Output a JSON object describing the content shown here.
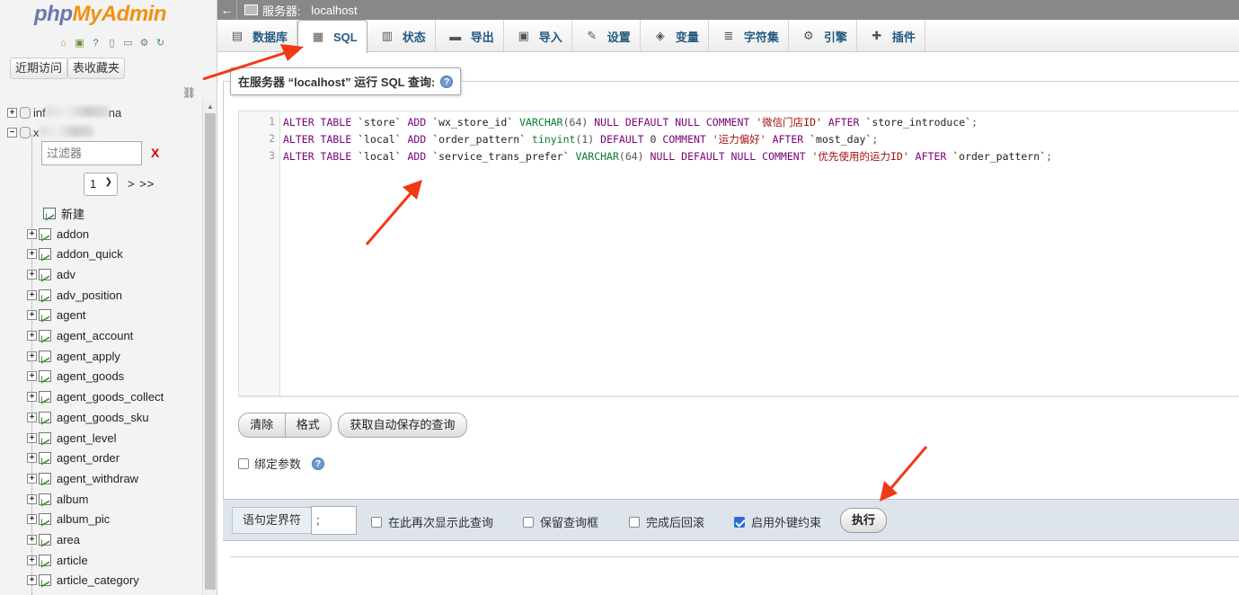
{
  "app": {
    "logo_php": "php",
    "logo_myadmin": "MyAdmin"
  },
  "nav": {
    "icons": [
      "home-icon",
      "logout-icon",
      "help-icon",
      "docs-icon",
      "copy-icon",
      "settings-icon",
      "reload-icon"
    ],
    "recent_button": "近期访问",
    "favorites_button": "表收藏夹",
    "databases": [
      {
        "name_prefix": "inf",
        "name_suffix": "na",
        "expanded": false
      },
      {
        "name_prefix": "x",
        "name_suffix": "",
        "expanded": true
      }
    ],
    "filter_placeholder": "过滤器",
    "filter_clear": "X",
    "page_select": "1",
    "page_next": "> >>",
    "new_label": "新建",
    "tables": [
      "addon",
      "addon_quick",
      "adv",
      "adv_position",
      "agent",
      "agent_account",
      "agent_apply",
      "agent_goods",
      "agent_goods_collect",
      "agent_goods_sku",
      "agent_level",
      "agent_order",
      "agent_withdraw",
      "album",
      "album_pic",
      "area",
      "article",
      "article_category"
    ]
  },
  "topbar": {
    "back": "←",
    "server_label": "服务器:",
    "server_name": "localhost"
  },
  "tabs": [
    {
      "label": "数据库",
      "icon": "database-icon"
    },
    {
      "label": "SQL",
      "icon": "sql-icon",
      "active": true
    },
    {
      "label": "状态",
      "icon": "status-icon"
    },
    {
      "label": "导出",
      "icon": "export-icon"
    },
    {
      "label": "导入",
      "icon": "import-icon"
    },
    {
      "label": "设置",
      "icon": "wrench-icon"
    },
    {
      "label": "变量",
      "icon": "variables-icon"
    },
    {
      "label": "字符集",
      "icon": "charset-icon"
    },
    {
      "label": "引擎",
      "icon": "engine-icon"
    },
    {
      "label": "插件",
      "icon": "plugin-icon"
    }
  ],
  "query": {
    "title": "在服务器 “localhost” 运行 SQL 查询:",
    "lines": [
      {
        "num": "1",
        "tokens": [
          [
            "kw",
            "ALTER TABLE "
          ],
          [
            "id",
            "`store` "
          ],
          [
            "kw",
            "ADD "
          ],
          [
            "id",
            "`wx_store_id` "
          ],
          [
            "ty",
            "VARCHAR"
          ],
          [
            "pn",
            "(64) "
          ],
          [
            "kw",
            "NULL DEFAULT NULL COMMENT "
          ],
          [
            "str",
            "'微信门店ID' "
          ],
          [
            "kw",
            "AFTER "
          ],
          [
            "id",
            "`store_introduce`"
          ],
          [
            "pn",
            ";"
          ]
        ]
      },
      {
        "num": "2",
        "tokens": [
          [
            "kw",
            "ALTER TABLE "
          ],
          [
            "id",
            "`local` "
          ],
          [
            "kw",
            "ADD "
          ],
          [
            "id",
            "`order_pattern` "
          ],
          [
            "ty",
            "tinyint"
          ],
          [
            "pn",
            "(1) "
          ],
          [
            "kw",
            "DEFAULT "
          ],
          [
            "num",
            "0 "
          ],
          [
            "kw",
            "COMMENT "
          ],
          [
            "str",
            "'运力偏好' "
          ],
          [
            "kw",
            "AFTER "
          ],
          [
            "id",
            "`most_day`"
          ],
          [
            "pn",
            ";"
          ]
        ]
      },
      {
        "num": "3",
        "tokens": [
          [
            "kw",
            "ALTER TABLE "
          ],
          [
            "id",
            "`local` "
          ],
          [
            "kw",
            "ADD "
          ],
          [
            "id",
            "`service_trans_prefer` "
          ],
          [
            "ty",
            "VARCHAR"
          ],
          [
            "pn",
            "(64) "
          ],
          [
            "kw",
            "NULL DEFAULT NULL COMMENT "
          ],
          [
            "str",
            "'优先使用的运力ID' "
          ],
          [
            "kw",
            "AFTER "
          ],
          [
            "id",
            "`order_pattern`"
          ],
          [
            "pn",
            ";"
          ]
        ]
      }
    ],
    "clear_button": "清除",
    "format_button": "格式",
    "autosave_button": "获取自动保存的查询",
    "bind_params_label": "绑定参数"
  },
  "footer": {
    "delimiter_label": "语句定界符",
    "delimiter_value": ";",
    "options": [
      {
        "label": "在此再次显示此查询",
        "checked": false
      },
      {
        "label": "保留查询框",
        "checked": false
      },
      {
        "label": "完成后回滚",
        "checked": false
      },
      {
        "label": "启用外键约束",
        "checked": true
      }
    ],
    "execute_button": "执行"
  },
  "colors": {
    "annotation_arrow": "#f03a17",
    "tab_text": "#235a81",
    "topbar_bg": "#888888"
  }
}
